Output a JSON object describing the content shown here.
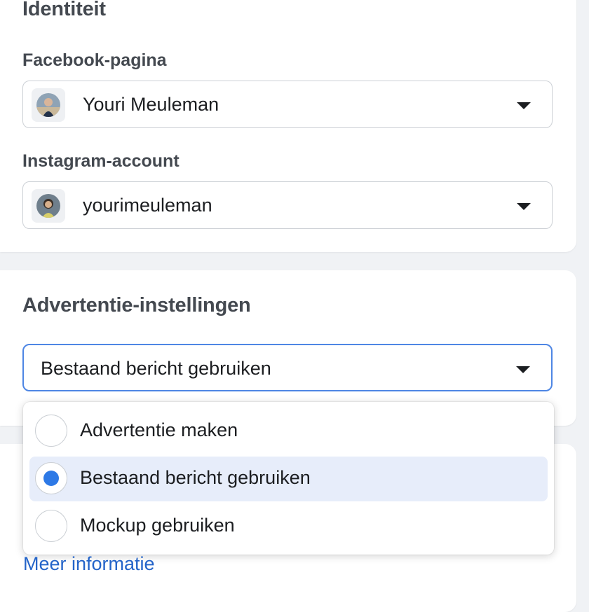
{
  "identity": {
    "title": "Identiteit",
    "facebook_label": "Facebook-pagina",
    "facebook_value": "Youri Meuleman",
    "instagram_label": "Instagram-account",
    "instagram_value": "yourimeuleman"
  },
  "ad_settings": {
    "title": "Advertentie-instellingen",
    "selected_value": "Bestaand bericht gebruiken",
    "options": [
      {
        "label": "Advertentie maken",
        "selected": false
      },
      {
        "label": "Bestaand bericht gebruiken",
        "selected": true
      },
      {
        "label": "Mockup gebruiken",
        "selected": false
      }
    ]
  },
  "more_info_link": "Meer informatie",
  "colors": {
    "accent": "#2d79e6",
    "focus_border": "#4e86e4",
    "selected_bg": "#e7edfa",
    "link": "#2464c9"
  }
}
